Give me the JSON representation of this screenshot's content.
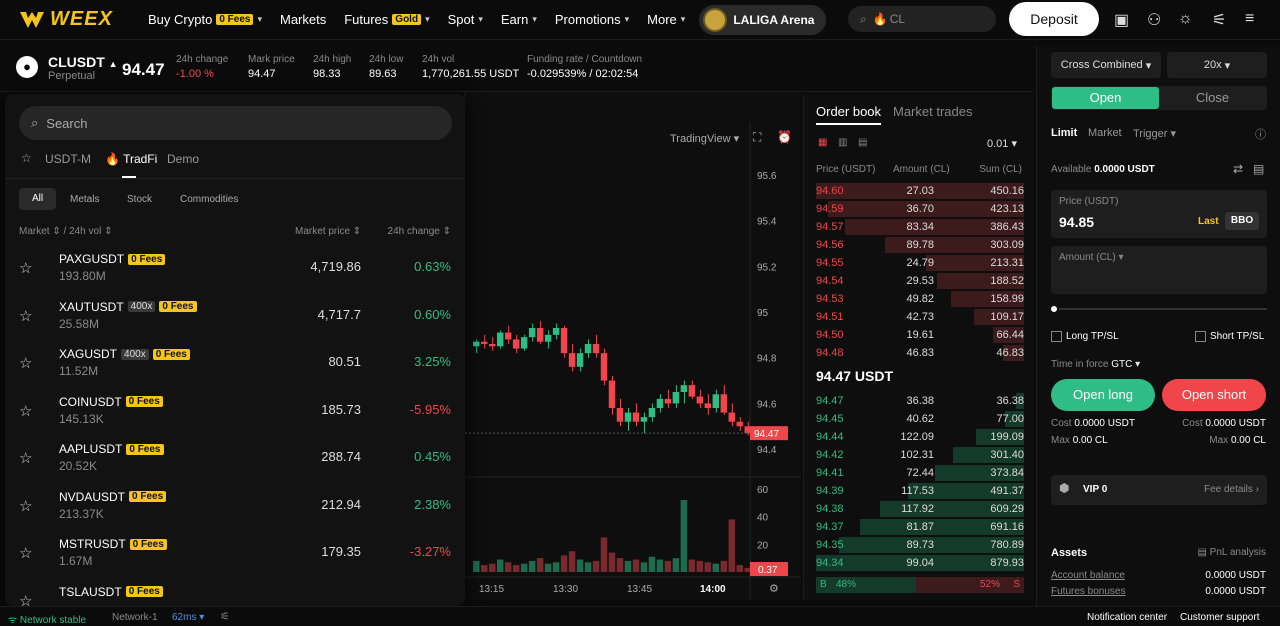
{
  "nav": {
    "logo_text": "WEEX",
    "items": [
      {
        "label": "Buy Crypto",
        "badge": "0 Fees",
        "chevron": true
      },
      {
        "label": "Markets",
        "badge": "",
        "chevron": false
      },
      {
        "label": "Futures",
        "badge": "Gold",
        "chevron": true
      },
      {
        "label": "Spot",
        "badge": "",
        "chevron": true
      },
      {
        "label": "Earn",
        "badge": "",
        "chevron": true
      },
      {
        "label": "Promotions",
        "badge": "",
        "chevron": true
      },
      {
        "label": "More",
        "badge": "",
        "chevron": true
      }
    ],
    "laliga": "LALIGA Arena",
    "search_value": "CL",
    "deposit": "Deposit",
    "icons": [
      "wallet-icon",
      "user-icon",
      "sun-icon",
      "settings-sliders-icon",
      "menu-icon"
    ]
  },
  "ticker": {
    "symbol": "CLUSDT",
    "sub": "Perpetual",
    "price": "94.47",
    "stats": [
      {
        "label": "24h change",
        "value": "-1.00 %",
        "color": "red"
      },
      {
        "label": "Mark price",
        "value": "94.47",
        "color": "white"
      },
      {
        "label": "24h high",
        "value": "98.33",
        "color": "white"
      },
      {
        "label": "24h low",
        "value": "89.63",
        "color": "white"
      },
      {
        "label": "24h vol",
        "value": "1,770,261.55 USDT",
        "color": "white"
      },
      {
        "label": "Funding rate / Countdown",
        "value": "-0.029539% / 02:02:54",
        "color": "white"
      }
    ]
  },
  "chart": {
    "tradingview_label": "TradingView",
    "price_axis": [
      "95.6",
      "95.4",
      "95.2",
      "95",
      "94.8",
      "94.6",
      "94.4"
    ],
    "last_price_tag": "94.47",
    "volume_axis": [
      "60",
      "40",
      "20"
    ],
    "volume_tag": "0.37",
    "time_axis": [
      "13:15",
      "13:30",
      "13:45",
      "14:00"
    ]
  },
  "chart_data": {
    "type": "candlestick",
    "ylim": [
      94.3,
      95.7
    ],
    "candles": [
      [
        94.85,
        94.88,
        94.82,
        94.87
      ],
      [
        94.87,
        94.9,
        94.84,
        94.86
      ],
      [
        94.86,
        94.89,
        94.83,
        94.85
      ],
      [
        94.85,
        94.92,
        94.84,
        94.91
      ],
      [
        94.91,
        94.94,
        94.86,
        94.88
      ],
      [
        94.88,
        94.9,
        94.82,
        94.84
      ],
      [
        94.84,
        94.9,
        94.83,
        94.89
      ],
      [
        94.89,
        94.95,
        94.87,
        94.93
      ],
      [
        94.93,
        94.96,
        94.86,
        94.87
      ],
      [
        94.87,
        94.92,
        94.84,
        94.9
      ],
      [
        94.9,
        94.95,
        94.88,
        94.93
      ],
      [
        94.93,
        94.94,
        94.8,
        94.82
      ],
      [
        94.82,
        94.86,
        94.74,
        94.76
      ],
      [
        94.76,
        94.84,
        94.74,
        94.82
      ],
      [
        94.82,
        94.88,
        94.8,
        94.86
      ],
      [
        94.86,
        94.9,
        94.8,
        94.82
      ],
      [
        94.82,
        94.84,
        94.68,
        94.7
      ],
      [
        94.7,
        94.72,
        94.55,
        94.58
      ],
      [
        94.58,
        94.62,
        94.5,
        94.52
      ],
      [
        94.52,
        94.58,
        94.48,
        94.56
      ],
      [
        94.56,
        94.6,
        94.5,
        94.52
      ],
      [
        94.52,
        94.56,
        94.47,
        94.54
      ],
      [
        94.54,
        94.6,
        94.52,
        94.58
      ],
      [
        94.58,
        94.64,
        94.56,
        94.62
      ],
      [
        94.62,
        94.66,
        94.58,
        94.6
      ],
      [
        94.6,
        94.68,
        94.58,
        94.65
      ],
      [
        94.65,
        94.7,
        94.6,
        94.68
      ],
      [
        94.68,
        94.7,
        94.62,
        94.63
      ],
      [
        94.63,
        94.66,
        94.58,
        94.6
      ],
      [
        94.6,
        94.64,
        94.55,
        94.58
      ],
      [
        94.58,
        94.66,
        94.56,
        94.64
      ],
      [
        94.64,
        94.68,
        94.55,
        94.56
      ],
      [
        94.56,
        94.6,
        94.5,
        94.52
      ],
      [
        94.52,
        94.54,
        94.48,
        94.5
      ],
      [
        94.5,
        94.52,
        94.46,
        94.47
      ]
    ],
    "volumes": [
      8,
      5,
      6,
      9,
      7,
      5,
      6,
      8,
      10,
      6,
      7,
      12,
      15,
      9,
      7,
      8,
      25,
      14,
      10,
      8,
      9,
      7,
      11,
      9,
      8,
      10,
      52,
      9,
      8,
      7,
      6,
      8,
      38,
      5,
      3
    ]
  },
  "orderbook": {
    "tabs": [
      "Order book",
      "Market trades"
    ],
    "precision": "0.01",
    "headers": [
      "Price (USDT)",
      "Amount (CL)",
      "Sum (CL)"
    ],
    "asks": [
      [
        "94.60",
        "27.03",
        "450.16",
        1.0
      ],
      [
        "94.59",
        "36.70",
        "423.13",
        0.94
      ],
      [
        "94.57",
        "83.34",
        "386.43",
        0.86
      ],
      [
        "94.56",
        "89.78",
        "303.09",
        0.67
      ],
      [
        "94.55",
        "24.79",
        "213.31",
        0.47
      ],
      [
        "94.54",
        "29.53",
        "188.52",
        0.42
      ],
      [
        "94.53",
        "49.82",
        "158.99",
        0.35
      ],
      [
        "94.51",
        "42.73",
        "109.17",
        0.24
      ],
      [
        "94.50",
        "19.61",
        "66.44",
        0.15
      ],
      [
        "94.48",
        "46.83",
        "46.83",
        0.1
      ]
    ],
    "mid": "94.47 USDT",
    "bids": [
      [
        "94.47",
        "36.38",
        "36.38",
        0.04
      ],
      [
        "94.45",
        "40.62",
        "77.00",
        0.09
      ],
      [
        "94.44",
        "122.09",
        "199.09",
        0.23
      ],
      [
        "94.42",
        "102.31",
        "301.40",
        0.34
      ],
      [
        "94.41",
        "72.44",
        "373.84",
        0.43
      ],
      [
        "94.39",
        "117.53",
        "491.37",
        0.56
      ],
      [
        "94.38",
        "117.92",
        "609.29",
        0.69
      ],
      [
        "94.37",
        "81.87",
        "691.16",
        0.79
      ],
      [
        "94.35",
        "89.73",
        "780.89",
        0.89
      ],
      [
        "94.34",
        "99.04",
        "879.93",
        1.0
      ]
    ],
    "buy_label": "B",
    "buy_pct": "48%",
    "sell_pct": "52%",
    "sell_label": "S"
  },
  "trade": {
    "margin_mode": "Cross Combined",
    "leverage": "20x",
    "open": "Open",
    "close": "Close",
    "order_types": [
      "Limit",
      "Market",
      "Trigger"
    ],
    "available_label": "Available",
    "available_value": "0.0000 USDT",
    "price_label": "Price (USDT)",
    "price_value": "94.85",
    "last": "Last",
    "bbo": "BBO",
    "amount_label": "Amount (CL)",
    "long_tpsl": "Long TP/SL",
    "short_tpsl": "Short TP/SL",
    "tif_label": "Time in force",
    "tif_value": "GTC",
    "open_long": "Open long",
    "open_short": "Open short",
    "cost_label": "Cost",
    "cost_long": "0.0000 USDT",
    "cost_short": "0.0000 USDT",
    "max_label": "Max",
    "max_long": "0.00 CL",
    "max_short": "0.00 CL",
    "vip": "VIP 0",
    "fee_details": "Fee details",
    "assets": "Assets",
    "pnl": "PnL analysis",
    "account_balance": "Account balance",
    "account_balance_value": "0.0000 USDT",
    "futures_bonuses": "Futures bonuses",
    "futures_bonuses_value": "0.0000 USDT"
  },
  "dropdown": {
    "search_placeholder": "Search",
    "tabs": [
      "USDT-M",
      "TradFi",
      "Demo"
    ],
    "filters": [
      "All",
      "Metals",
      "Stock",
      "Commodities"
    ],
    "col_market": "Market",
    "col_vol": "24h vol",
    "col_price": "Market price",
    "col_change": "24h change",
    "markets": [
      {
        "sym": "PAXGUSDT",
        "lev": "",
        "badge": "0 Fees",
        "vol": "193.80M",
        "price": "4,719.86",
        "chg": "0.63%",
        "up": true
      },
      {
        "sym": "XAUTUSDT",
        "lev": "400x",
        "badge": "0 Fees",
        "vol": "25.58M",
        "price": "4,717.7",
        "chg": "0.60%",
        "up": true
      },
      {
        "sym": "XAGUSDT",
        "lev": "400x",
        "badge": "0 Fees",
        "vol": "11.52M",
        "price": "80.51",
        "chg": "3.25%",
        "up": true
      },
      {
        "sym": "COINUSDT",
        "lev": "",
        "badge": "0 Fees",
        "vol": "145.13K",
        "price": "185.73",
        "chg": "-5.95%",
        "up": false
      },
      {
        "sym": "AAPLUSDT",
        "lev": "",
        "badge": "0 Fees",
        "vol": "20.52K",
        "price": "288.74",
        "chg": "0.45%",
        "up": true
      },
      {
        "sym": "NVDAUSDT",
        "lev": "",
        "badge": "0 Fees",
        "vol": "213.37K",
        "price": "212.94",
        "chg": "2.38%",
        "up": true
      },
      {
        "sym": "MSTRUSDT",
        "lev": "",
        "badge": "0 Fees",
        "vol": "1.67M",
        "price": "179.35",
        "chg": "-3.27%",
        "up": false
      },
      {
        "sym": "TSLAUSDT",
        "lev": "",
        "badge": "0 Fees",
        "vol": "",
        "price": "",
        "chg": "",
        "up": true
      }
    ]
  },
  "footer": {
    "network": "Network stable",
    "network_name": "Network-1",
    "latency": "62ms",
    "notification": "Notification center",
    "support": "Customer support"
  },
  "colors": {
    "accent": "#f5c518",
    "up": "#2ebd85",
    "down": "#f0464b"
  }
}
